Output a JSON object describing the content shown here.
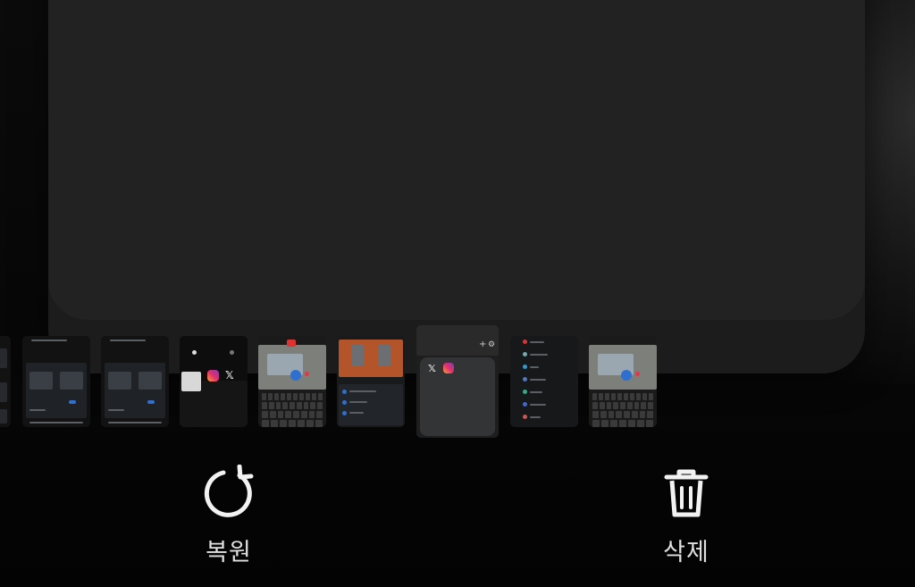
{
  "actions": {
    "restore": {
      "label": "복원",
      "icon": "restore-icon"
    },
    "delete": {
      "label": "삭제",
      "icon": "trash-icon"
    }
  },
  "thumbnails": [
    {
      "name": "thumb-partial-left"
    },
    {
      "name": "thumb-settings-1"
    },
    {
      "name": "thumb-settings-2"
    },
    {
      "name": "thumb-home-instagram-x",
      "icons": [
        "instagram-icon",
        "x-icon"
      ]
    },
    {
      "name": "thumb-camera-keyboard-1"
    },
    {
      "name": "thumb-photo-building"
    },
    {
      "name": "thumb-folder-selected",
      "icons": [
        "x-icon",
        "instagram-icon"
      ]
    },
    {
      "name": "thumb-app-list"
    },
    {
      "name": "thumb-camera-keyboard-2"
    }
  ],
  "colors": {
    "background": "#050505",
    "preview": "#222222",
    "accent_blue": "#2f6fd0",
    "label": "#e0e0e0"
  }
}
